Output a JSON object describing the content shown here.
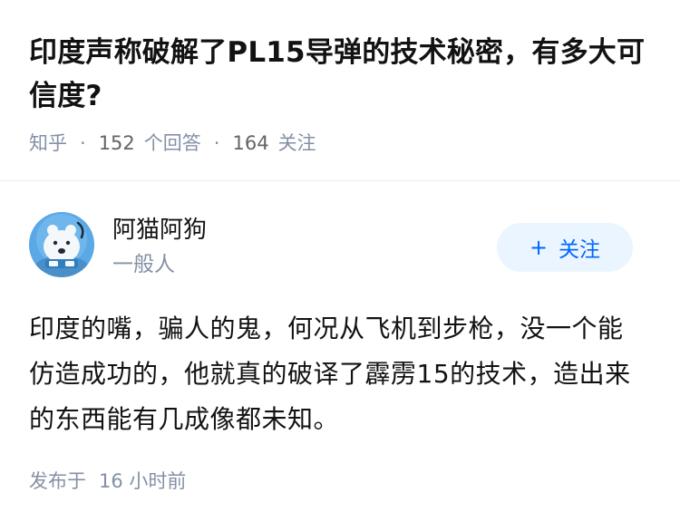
{
  "question": {
    "title": "印度声称破解了PL15导弹的技术秘密，有多大可信度?",
    "source": "知乎",
    "answer_count": "152",
    "answer_count_label": "个回答",
    "follower_count": "164",
    "follower_count_label": "关注",
    "separator": "·"
  },
  "author": {
    "name": "阿猫阿狗",
    "description": "一般人",
    "follow_icon": "plus-icon",
    "follow_label": "关注",
    "accent_color": "#0066ff",
    "follow_bg_color": "#ebf5ff"
  },
  "answer": {
    "content": "印度的嘴，骗人的鬼，何况从飞机到步枪，没一个能仿造成功的，他就真的破译了霹雳15的技术，造出来的东西能有几成像都未知。"
  },
  "footer": {
    "published_label": "发布于",
    "published_time": "16 小时前"
  }
}
